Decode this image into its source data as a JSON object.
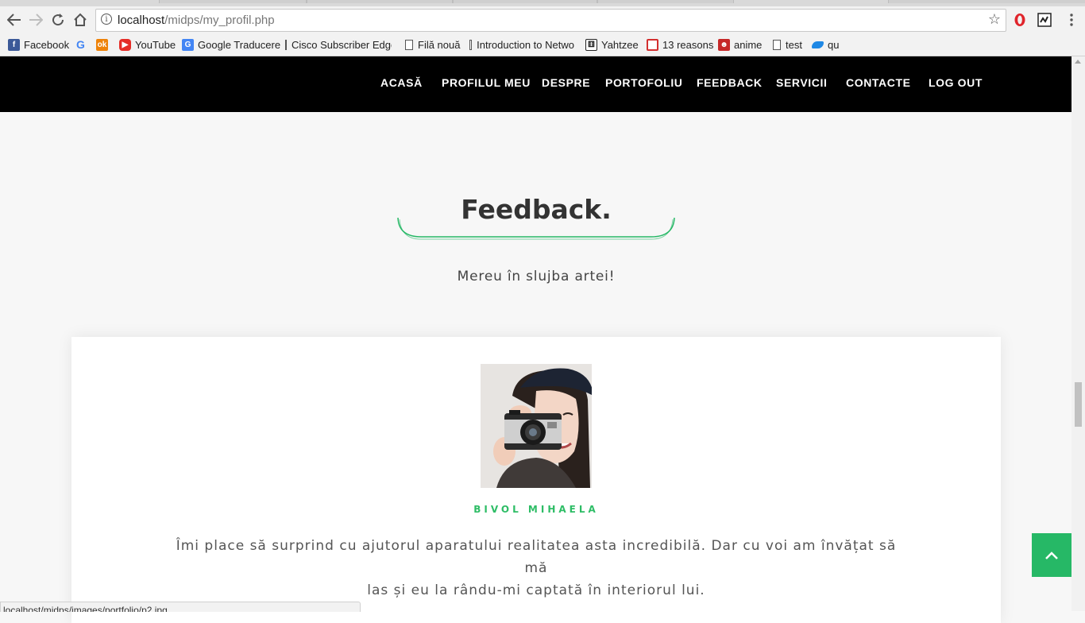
{
  "browser": {
    "url_host": "localhost",
    "url_path": "/midps/my_profil.php",
    "status_url": "localhost/midps/images/portfolio/p2.jpg",
    "bookmarks": [
      {
        "label": "Facebook",
        "icon": "facebook-icon",
        "color": "#3b5998"
      },
      {
        "label": "",
        "icon": "google-icon",
        "color": "#4285f4"
      },
      {
        "label": "",
        "icon": "odnoklassniki-icon",
        "color": "#ee8208"
      },
      {
        "label": "YouTube",
        "icon": "youtube-icon",
        "color": "#e52d27"
      },
      {
        "label": "Google Traducere",
        "icon": "translate-icon",
        "color": "#4285f4"
      },
      {
        "label": "Cisco Subscriber Edge",
        "icon": "page-icon",
        "color": "#555555"
      },
      {
        "label": "Filă nouă",
        "icon": "page-icon",
        "color": "#555555"
      },
      {
        "label": "Introduction to Netwo",
        "icon": "page-icon",
        "color": "#555555"
      },
      {
        "label": "Yahtzee",
        "icon": "dice-icon",
        "color": "#222222"
      },
      {
        "label": "13 reasons",
        "icon": "tv-icon",
        "color": "#d32f2f"
      },
      {
        "label": "anime",
        "icon": "anime-icon",
        "color": "#c62828"
      },
      {
        "label": "test",
        "icon": "page-icon",
        "color": "#555555"
      },
      {
        "label": "qu",
        "icon": "cloud-icon",
        "color": "#1e88e5"
      }
    ]
  },
  "nav": {
    "items": [
      "ACASĂ",
      "PROFILUL MEU",
      "DESPRE",
      "PORTOFOLIU",
      "FEEDBACK",
      "SERVICII",
      "CONTACTE",
      "LOG OUT"
    ]
  },
  "section": {
    "title": "Feedback.",
    "subtitle": "Mereu în slujba artei!"
  },
  "testimonial": {
    "name": "BIVOL MIHAELA",
    "quote_line1": "Îmi place să surprind cu ajutorul aparatului realitatea asta incredibilă. Dar cu voi am învățat să mă",
    "quote_line2": "las și eu la rându-mi captată în interiorul lui."
  },
  "colors": {
    "accent": "#26b866",
    "nav_bg": "#000000"
  }
}
